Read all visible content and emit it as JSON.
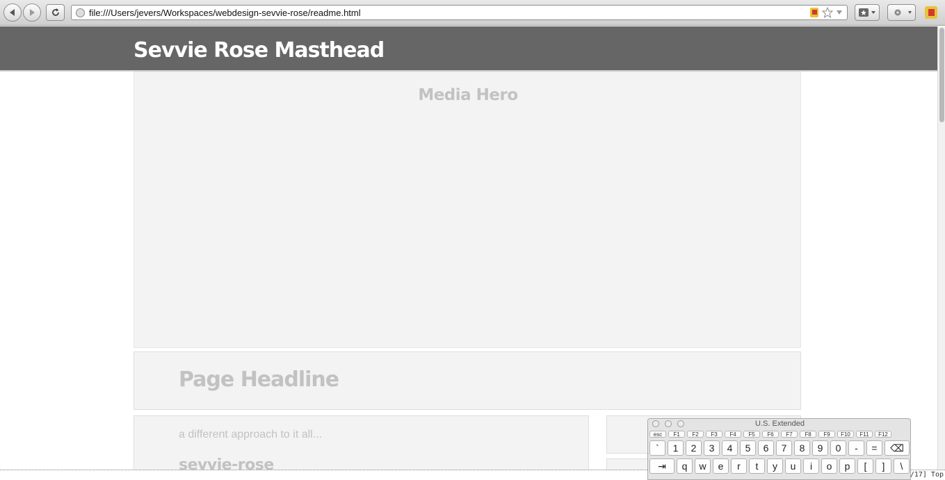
{
  "browser": {
    "url": "file:///Users/jevers/Workspaces/webdesign-sevvie-rose/readme.html"
  },
  "page": {
    "masthead_title": "Sevvie Rose Masthead",
    "hero_title": "Media Hero",
    "headline": "Page Headline",
    "tagline": "a different approach to it all...",
    "subhead": "sevvie-rose"
  },
  "status": {
    "text": "3/17] Top"
  },
  "keyboard": {
    "title": "U.S. Extended",
    "function_keys": [
      "esc",
      "F1",
      "F2",
      "F3",
      "F4",
      "F5",
      "F6",
      "F7",
      "F8",
      "F9",
      "F10",
      "F11",
      "F12"
    ],
    "row1": [
      "`",
      "1",
      "2",
      "3",
      "4",
      "5",
      "6",
      "7",
      "8",
      "9",
      "0",
      "-",
      "=",
      "⌫"
    ],
    "row2": [
      "⇥",
      "q",
      "w",
      "e",
      "r",
      "t",
      "y",
      "u",
      "i",
      "o",
      "p",
      "[",
      "]",
      "\\"
    ]
  },
  "colors": {
    "masthead_bg": "#666666",
    "panel_bg": "#f3f3f3",
    "placeholder_text": "#c2c2c2"
  }
}
